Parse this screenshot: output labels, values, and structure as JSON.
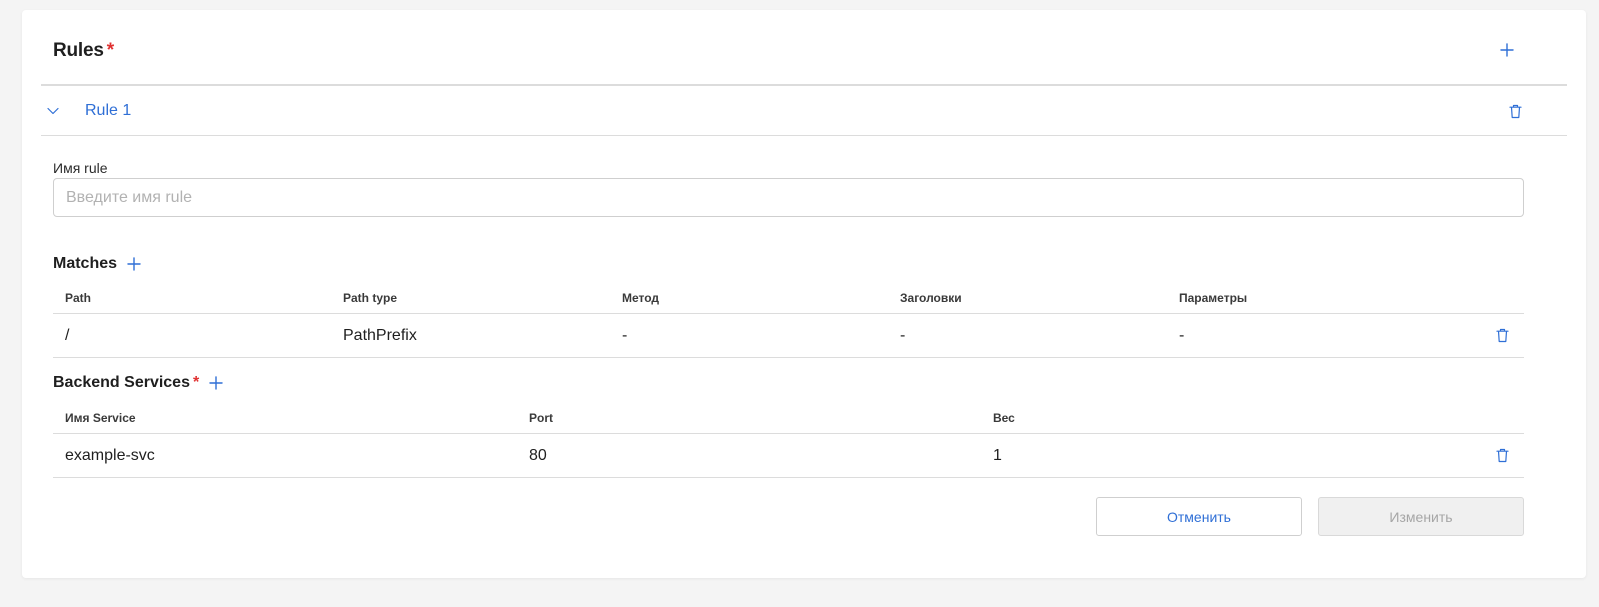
{
  "rules": {
    "title": "Rules",
    "required_marker": "*",
    "add_icon": "plus-icon"
  },
  "rule": {
    "title": "Rule 1",
    "expanded": true,
    "name_label": "Имя rule",
    "name_value": "",
    "name_placeholder": "Введите имя rule"
  },
  "matches": {
    "title": "Matches",
    "columns": [
      "Path",
      "Path type",
      "Метод",
      "Заголовки",
      "Параметры"
    ],
    "rows": [
      {
        "path": "/",
        "path_type": "PathPrefix",
        "method": "-",
        "headers": "-",
        "params": "-"
      }
    ]
  },
  "backend_services": {
    "title": "Backend Services",
    "required_marker": "*",
    "columns": [
      "Имя Service",
      "Port",
      "Вес"
    ],
    "rows": [
      {
        "service": "example-svc",
        "port": "80",
        "weight": "1"
      }
    ]
  },
  "actions": {
    "cancel_label": "Отменить",
    "submit_label": "Изменить",
    "submit_disabled": true
  },
  "colors": {
    "accent": "#2f6fd6",
    "required": "#e03131",
    "divider": "#dcdcdc",
    "background": "#f4f4f4"
  }
}
